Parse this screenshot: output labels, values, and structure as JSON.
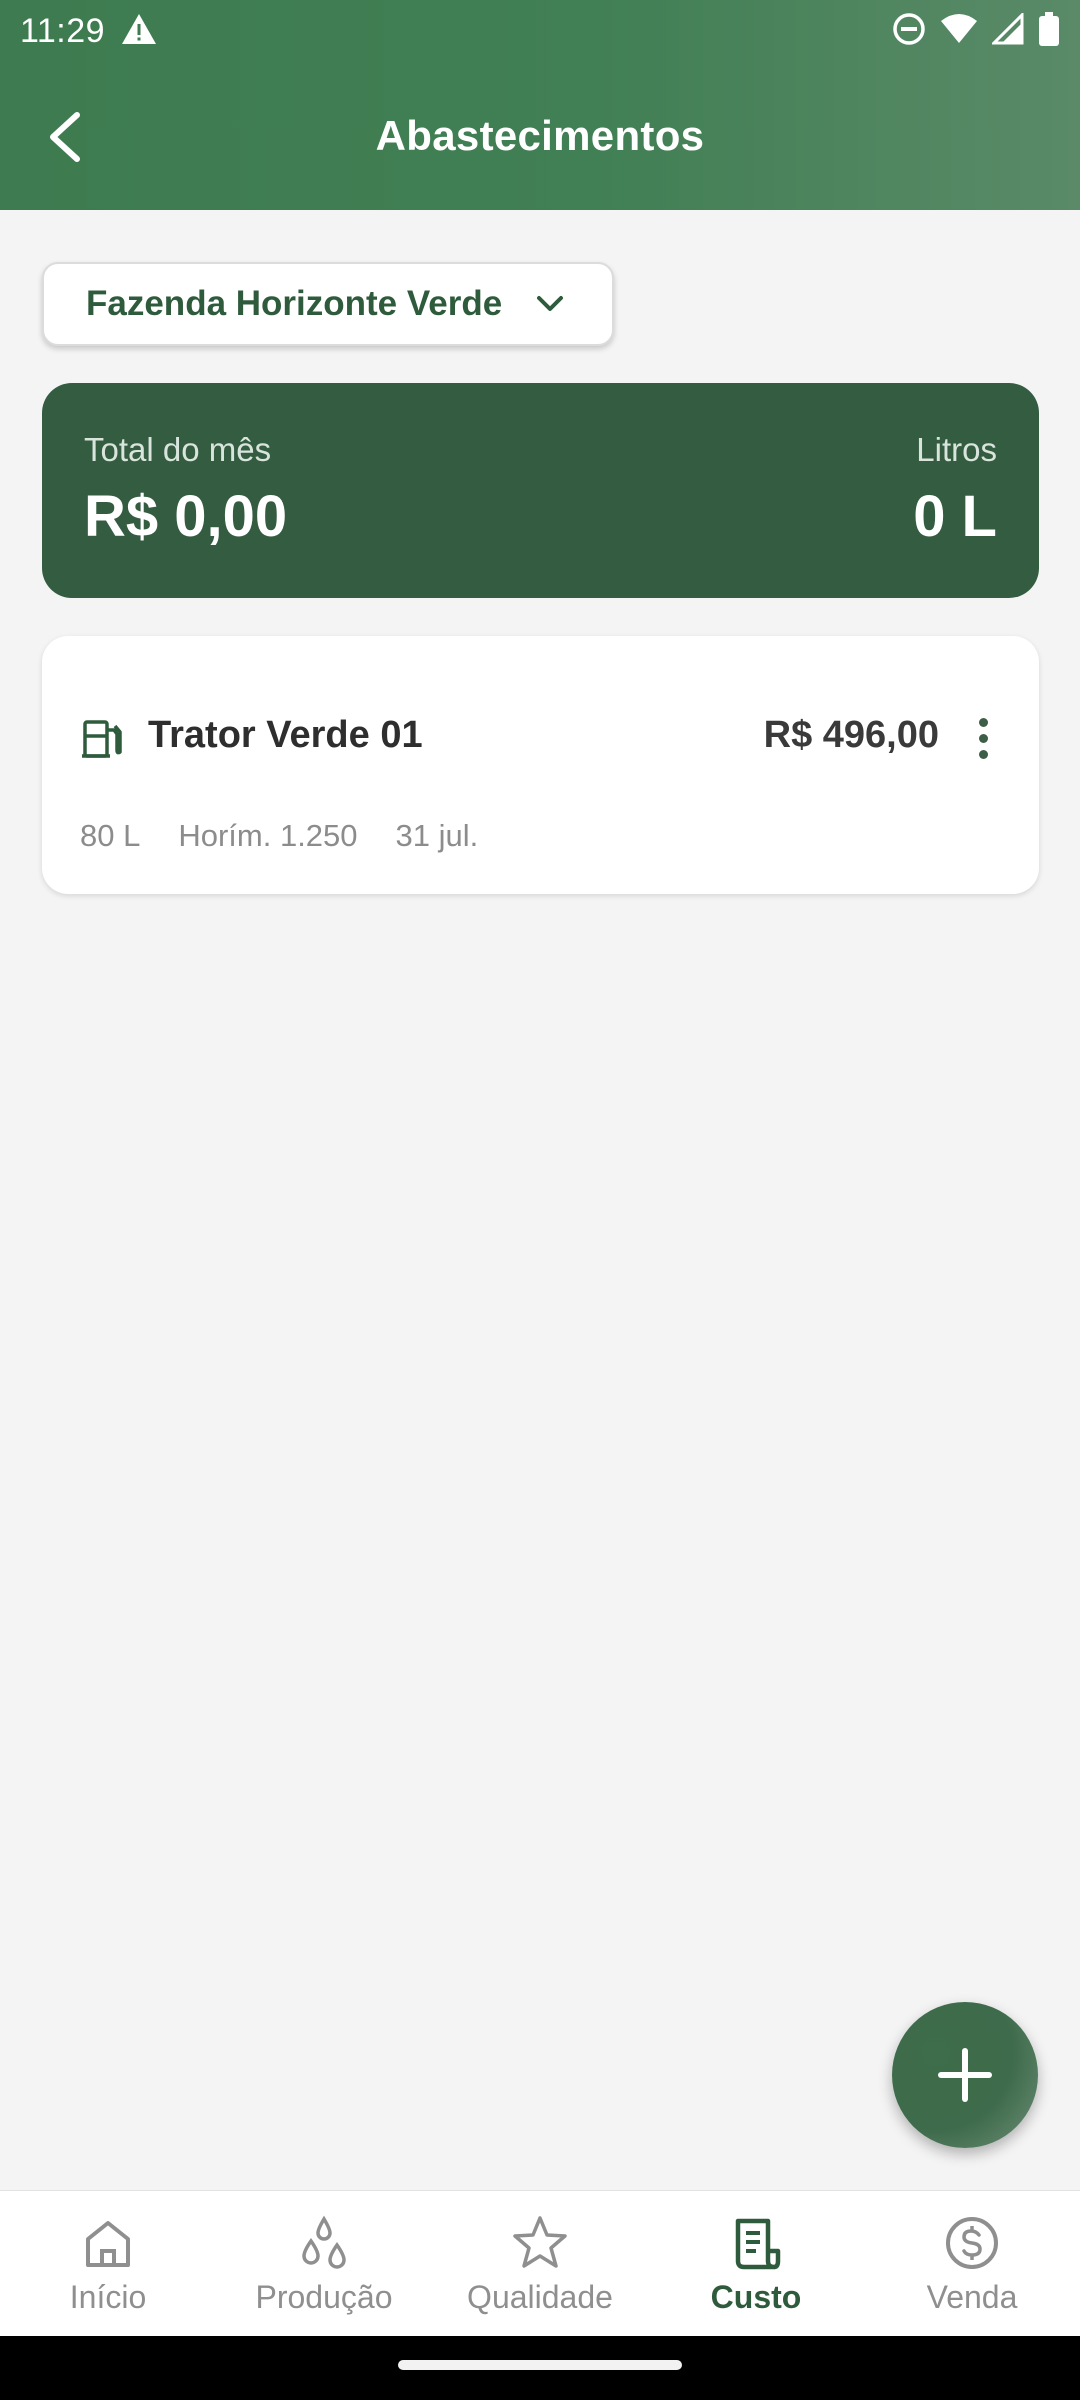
{
  "status_bar": {
    "time": "11:29"
  },
  "app_bar": {
    "title": "Abastecimentos",
    "back_icon": "arrow-back-icon"
  },
  "farm_selector": {
    "selected": "Fazenda Horizonte Verde",
    "icon": "chevron-down-icon"
  },
  "summary": {
    "total_label": "Total do mês",
    "total_value": "R$ 0,00",
    "liters_label": "Litros",
    "liters_value": "0 L"
  },
  "records": [
    {
      "name": "Trator Verde 01",
      "price": "R$ 496,00",
      "liters": "80 L",
      "hourmeter": "Horím. 1.250",
      "date": "31 jul.",
      "icon": "fuel-pump-icon"
    }
  ],
  "bottom_nav": {
    "active": "Custo",
    "items": [
      {
        "label": "Início",
        "icon": "home-icon"
      },
      {
        "label": "Produção",
        "icon": "drops-icon"
      },
      {
        "label": "Qualidade",
        "icon": "star-icon"
      },
      {
        "label": "Custo",
        "icon": "receipt-icon"
      },
      {
        "label": "Venda",
        "icon": "dollar-circle-icon"
      }
    ]
  },
  "colors": {
    "primary": "#3e7b50",
    "summary_card": "#335c40",
    "active_nav": "#2f5b3d",
    "background": "#f4f4f4"
  }
}
